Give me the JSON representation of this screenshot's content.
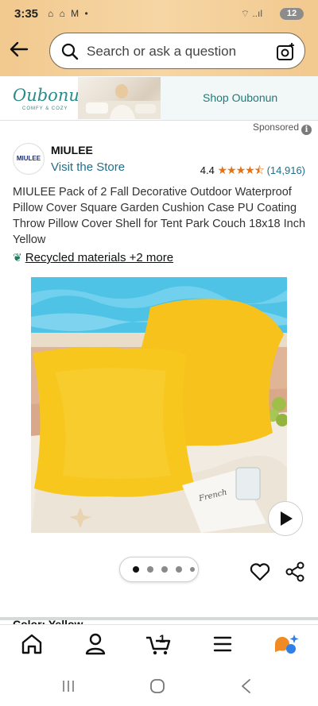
{
  "status": {
    "time": "3:35",
    "notifications": "⌂ ⌂ M •",
    "signal": "⌔ ..ıl",
    "battery": "12"
  },
  "search": {
    "placeholder": "Search or ask a question"
  },
  "ad": {
    "logo": "Oubonun",
    "logo_tagline": "COMFY & COZY",
    "shop_label": "Shop Oubonun",
    "sponsored_label": "Sponsored"
  },
  "product": {
    "brand": "MIULEE",
    "brand_logo_text": "MIULEE",
    "visit_store": "Visit the Store",
    "rating": "4.4",
    "stars": "★★★★⯪",
    "rating_value": 4.4,
    "rating_count": "(14,916)",
    "title": "MIULEE Pack of 2 Fall Decorative Outdoor Waterproof Pillow Cover Square Garden Cushion Case PU Coating Throw Pillow Cover Shell for Tent Park Couch 18x18 Inch Yellow",
    "sustainability": "Recycled materials +2 more",
    "image_description": "two yellow square pillows by a pool",
    "image_count": 5,
    "active_image": 1
  },
  "partial_section": {
    "text": "Color: Yellow"
  },
  "bottom_nav": {
    "cart_count": "1"
  },
  "colors": {
    "accent": "#e57315",
    "link": "#1f6f8b",
    "pillow": "#f5c518",
    "header": "#f2c98f"
  }
}
